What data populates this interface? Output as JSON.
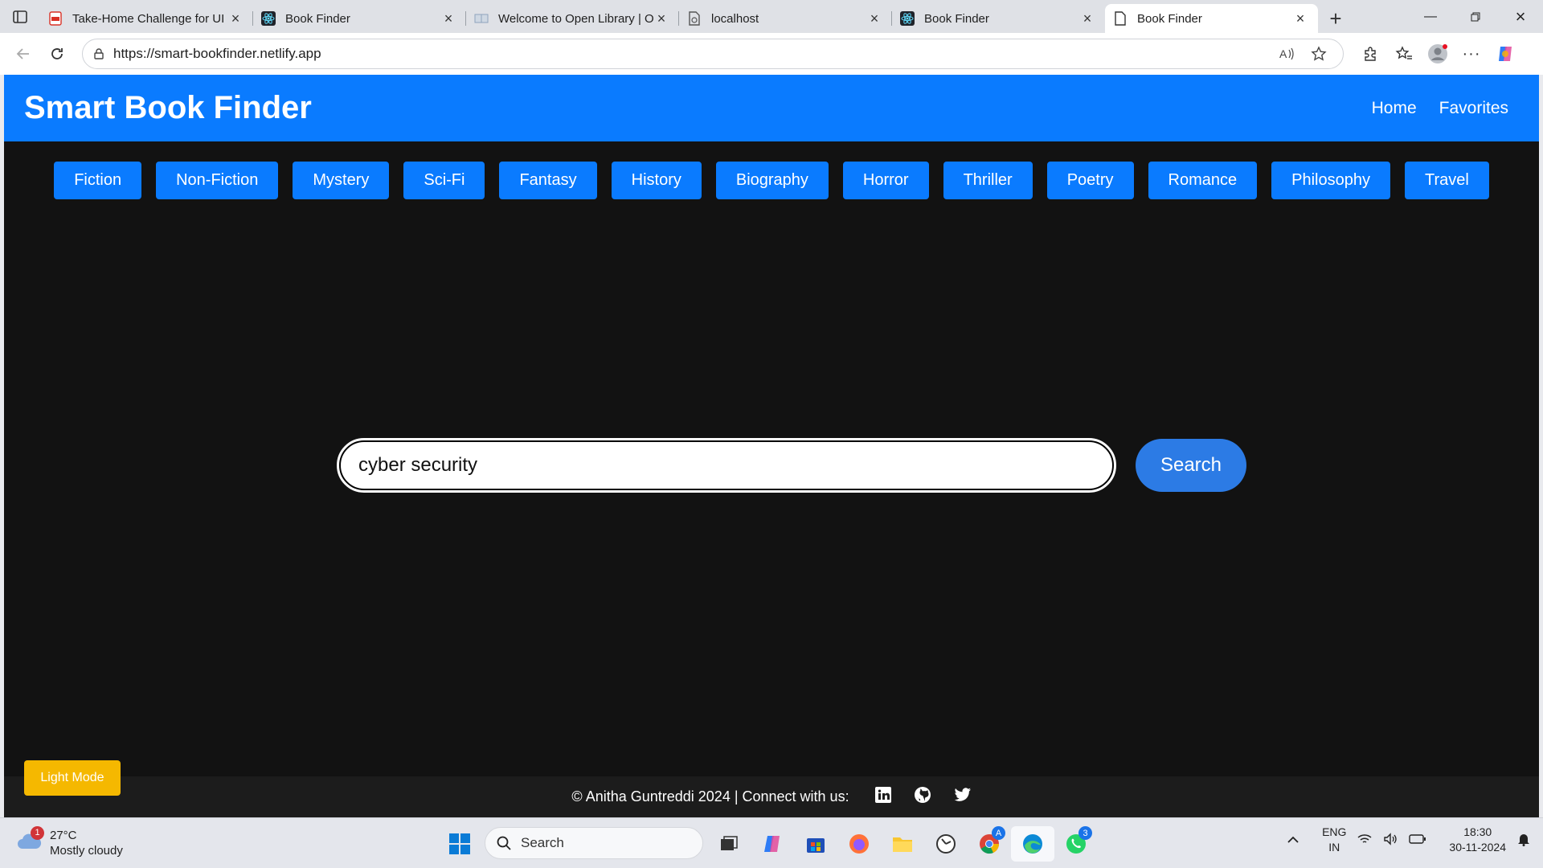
{
  "browser": {
    "tabs": [
      {
        "title": "Take-Home Challenge for UI",
        "icon": "pdf-icon",
        "active": false
      },
      {
        "title": "Book Finder",
        "icon": "react-icon",
        "active": false
      },
      {
        "title": "Welcome to Open Library | O",
        "icon": "openlibrary-icon",
        "active": false
      },
      {
        "title": "localhost",
        "icon": "page-error-icon",
        "active": false
      },
      {
        "title": "Book Finder",
        "icon": "react-icon",
        "active": false
      },
      {
        "title": "Book Finder",
        "icon": "document-icon",
        "active": true
      }
    ],
    "url": "https://smart-bookfinder.netlify.app"
  },
  "app": {
    "brand": "Smart Book Finder",
    "nav": [
      "Home",
      "Favorites"
    ],
    "genres": [
      "Fiction",
      "Non-Fiction",
      "Mystery",
      "Sci-Fi",
      "Fantasy",
      "History",
      "Biography",
      "Horror",
      "Thriller",
      "Poetry",
      "Romance",
      "Philosophy",
      "Travel"
    ],
    "search": {
      "value": "cyber security",
      "button": "Search"
    },
    "theme_toggle": "Light Mode",
    "footer": {
      "text": "© Anitha Guntreddi 2024 | Connect with us:",
      "socials": [
        "linkedin-icon",
        "github-icon",
        "twitter-icon"
      ]
    },
    "colors": {
      "header": "#0a7bff",
      "background": "#121212",
      "search_button": "#2c7be5",
      "theme_button": "#f5b800"
    }
  },
  "taskbar": {
    "weather": {
      "temp": "27°C",
      "condition": "Mostly cloudy",
      "badge": "1"
    },
    "search_placeholder": "Search",
    "whatsapp_badge": "3",
    "chrome_badge": "A",
    "language": {
      "line1": "ENG",
      "line2": "IN"
    },
    "time": "18:30",
    "date": "30-11-2024"
  }
}
